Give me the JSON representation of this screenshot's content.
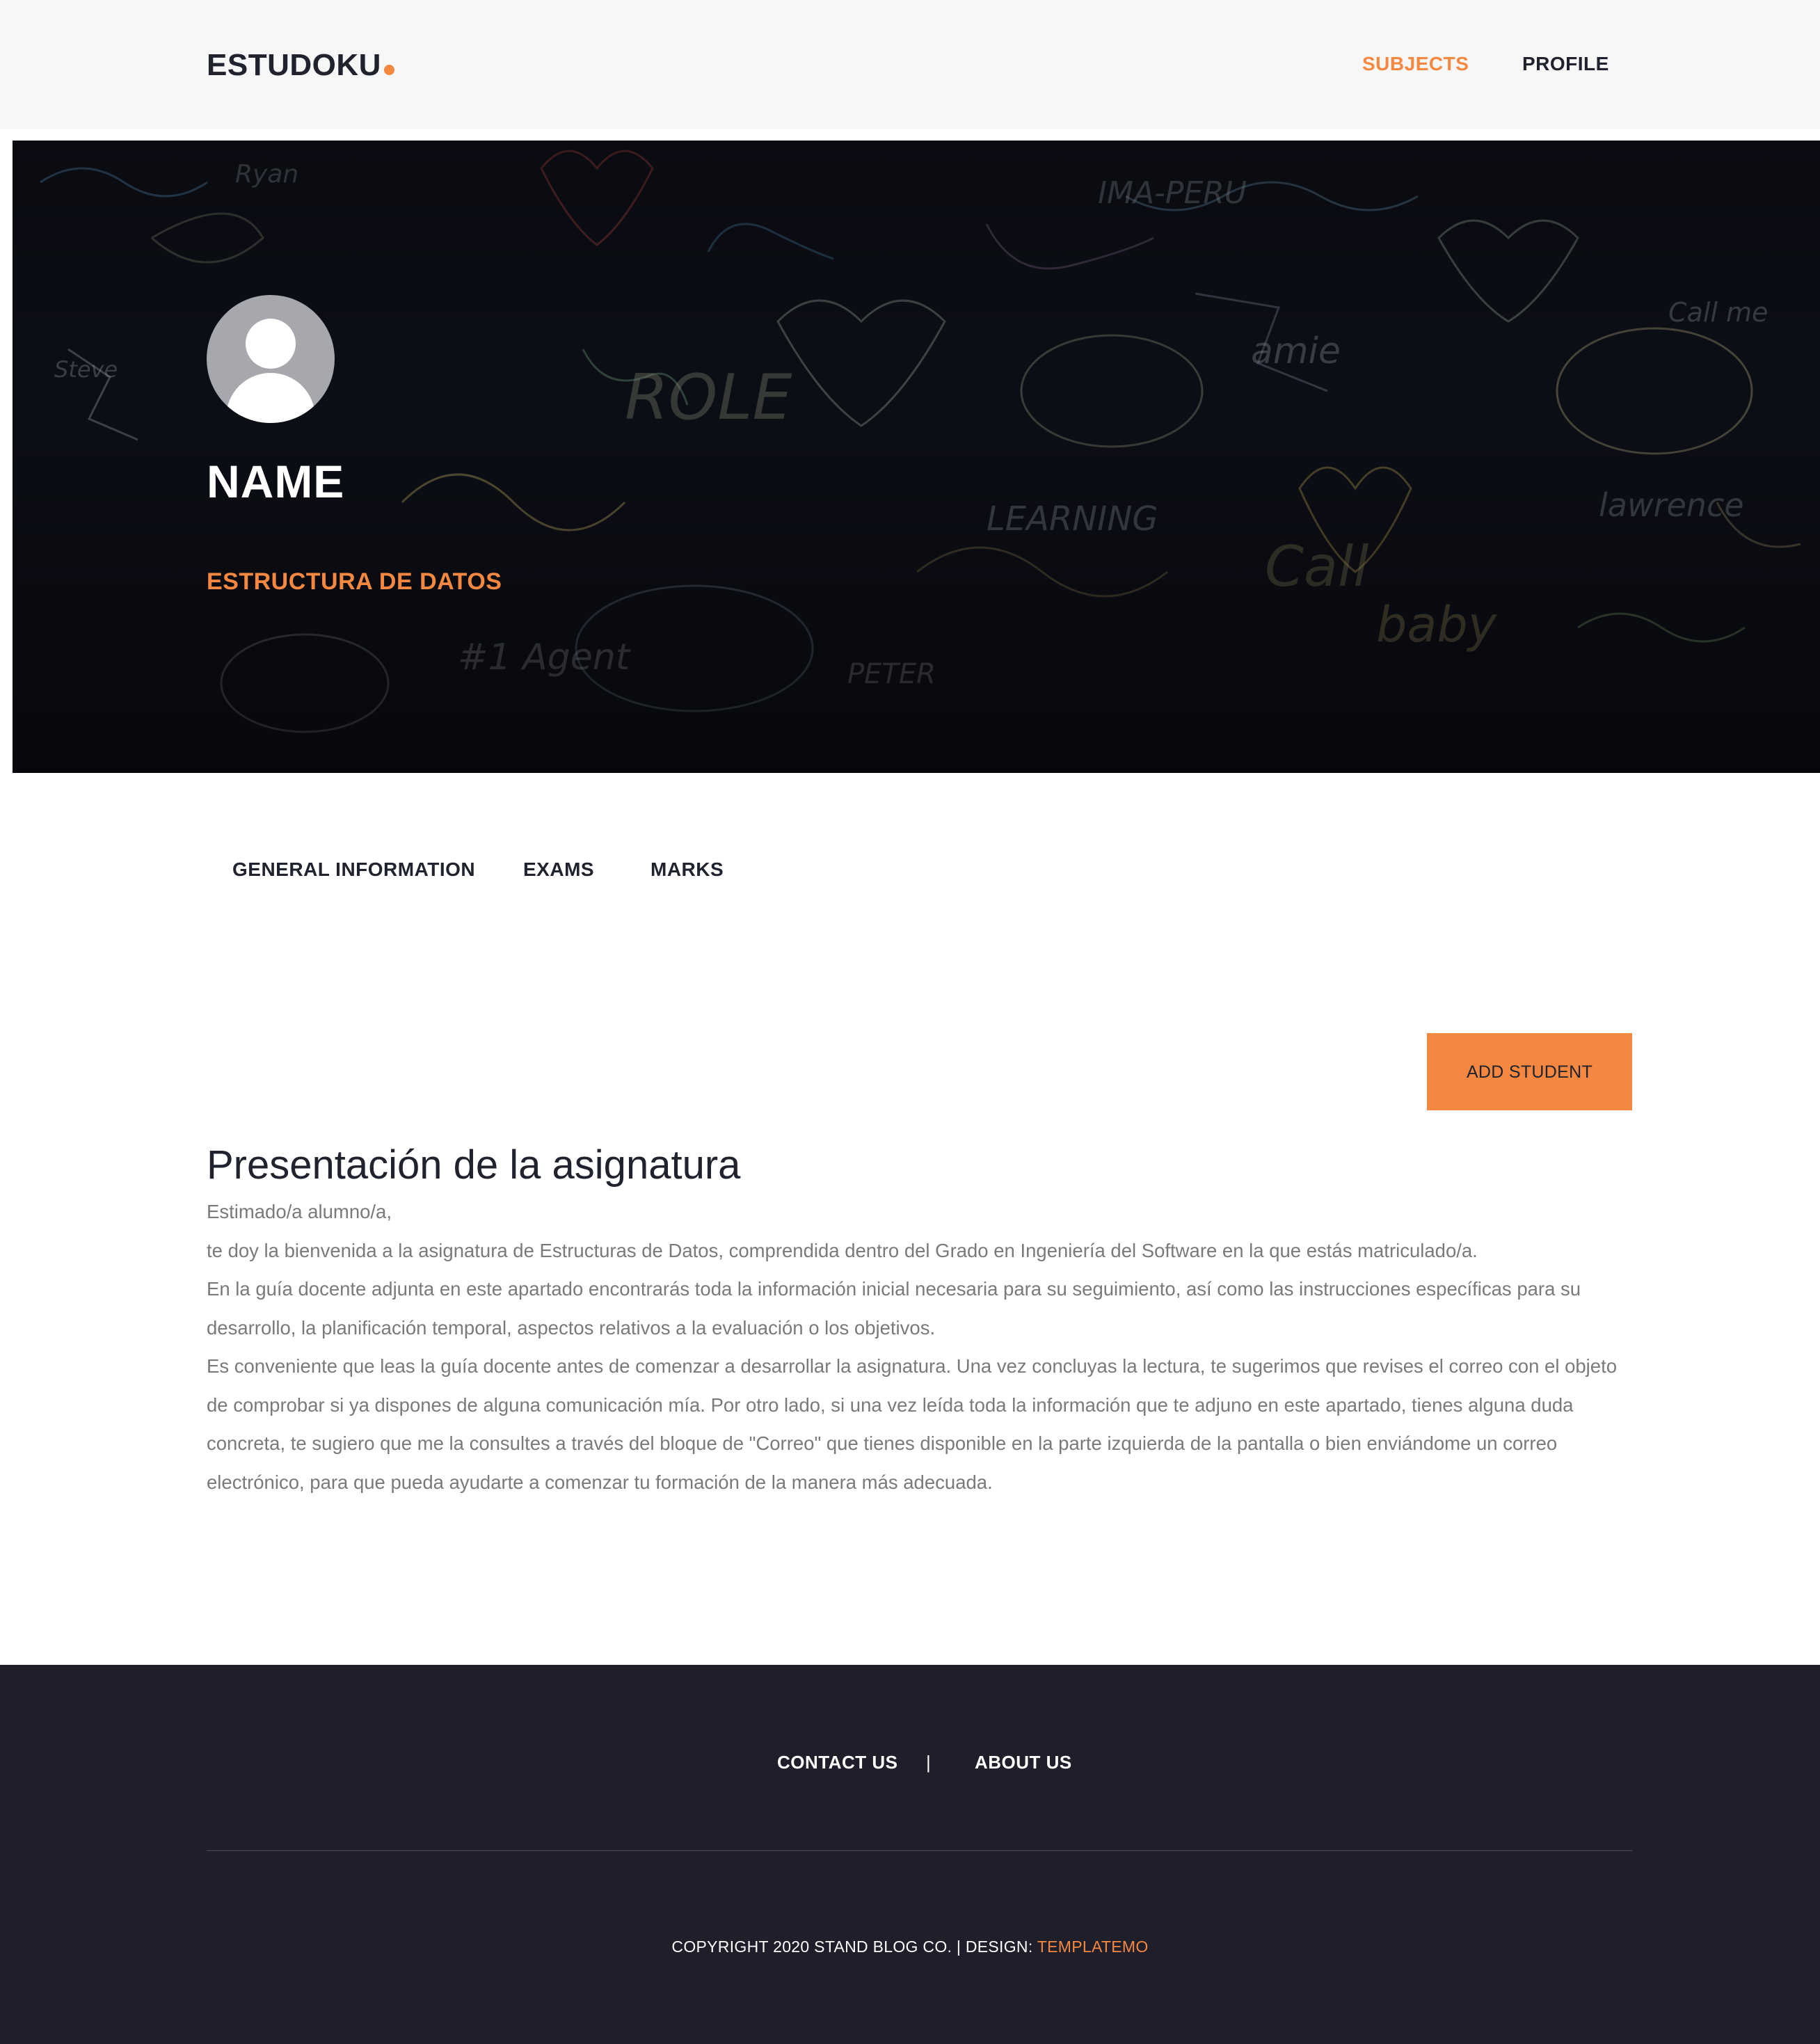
{
  "brand": {
    "logo_text": "ESTUDOKU",
    "accent_color": "#f48840",
    "dark_color": "#20232e",
    "footer_bg": "#1f1f2b"
  },
  "nav": {
    "items": [
      {
        "label": "SUBJECTS",
        "active": true
      },
      {
        "label": "PROFILE",
        "active": false
      }
    ]
  },
  "hero": {
    "avatar_icon": "user-avatar-icon",
    "name": "NAME",
    "subject": "ESTRUCTURA DE DATOS"
  },
  "tabs": [
    {
      "label": "GENERAL INFORMATION"
    },
    {
      "label": "EXAMS"
    },
    {
      "label": "MARKS"
    }
  ],
  "actions": {
    "add_student_label": "ADD STUDENT"
  },
  "content": {
    "title": "Presentación de la asignatura",
    "lines": [
      "Estimado/a alumno/a,",
      "te doy la bienvenida a la asignatura de Estructuras de Datos, comprendida dentro del Grado en Ingeniería del Software en la que estás matriculado/a.",
      "En la guía docente adjunta en este apartado encontrarás toda la información inicial necesaria para su seguimiento, así como las instrucciones específicas para su",
      "desarrollo, la planificación temporal, aspectos relativos a la evaluación o los objetivos.",
      "Es conveniente que leas la guía docente antes de comenzar a desarrollar la asignatura. Una vez concluyas la lectura, te sugerimos que revises el correo con el objeto",
      "de comprobar si ya dispones de alguna comunicación mía. Por otro lado, si una vez leída toda la información que te adjuno en este apartado, tienes alguna duda",
      "concreta, te sugiero que me la consultes a través del bloque de \"Correo\" que tienes disponible en la parte izquierda de la pantalla o bien enviándome un correo",
      "electrónico, para que pueda ayudarte a comenzar tu formación de la manera más adecuada."
    ]
  },
  "footer": {
    "contact_label": "CONTACT US",
    "separator": "|",
    "about_label": "ABOUT US",
    "copyright_text": "COPYRIGHT 2020 STAND BLOG CO. | DESIGN: ",
    "design_link": "TEMPLATEMO"
  }
}
